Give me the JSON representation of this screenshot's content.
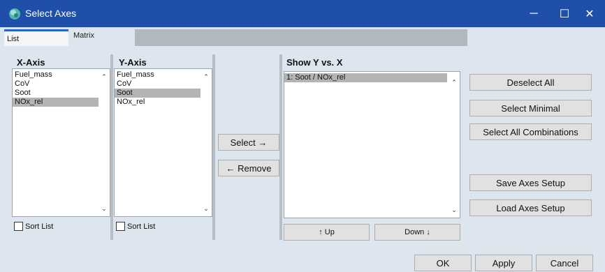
{
  "window": {
    "title": "Select Axes",
    "controls": {
      "minimize": "─",
      "maximize": "☐",
      "close": "✕"
    }
  },
  "tabs": {
    "list": "List",
    "matrix": "Matrix"
  },
  "x_axis": {
    "header": "X-Axis",
    "items": [
      "Fuel_mass",
      "CoV",
      "Soot",
      "NOx_rel"
    ],
    "selected": "NOx_rel",
    "sort_label": "Sort List",
    "sort_checked": false
  },
  "y_axis": {
    "header": "Y-Axis",
    "items": [
      "Fuel_mass",
      "CoV",
      "Soot",
      "NOx_rel"
    ],
    "selected": "Soot",
    "sort_label": "Sort List",
    "sort_checked": false
  },
  "middle": {
    "select_label": "Select →",
    "remove_label": "← Remove"
  },
  "show": {
    "header": "Show Y vs. X",
    "items": [
      "1: Soot / NOx_rel"
    ],
    "selected": "1: Soot / NOx_rel",
    "up_label": "↑ Up",
    "down_label": "Down ↓"
  },
  "right_buttons": {
    "deselect_all": "Deselect All",
    "select_minimal": "Select Minimal",
    "select_all_combinations": "Select All Combinations",
    "save_setup": "Save Axes Setup",
    "load_setup": "Load Axes Setup"
  },
  "footer": {
    "ok": "OK",
    "apply": "Apply",
    "cancel": "Cancel"
  },
  "colors": {
    "titlebar": "#1f4fa8",
    "background": "#dde5ee",
    "selection": "#b4b4b4",
    "tab_accent": "#2a64c6"
  }
}
